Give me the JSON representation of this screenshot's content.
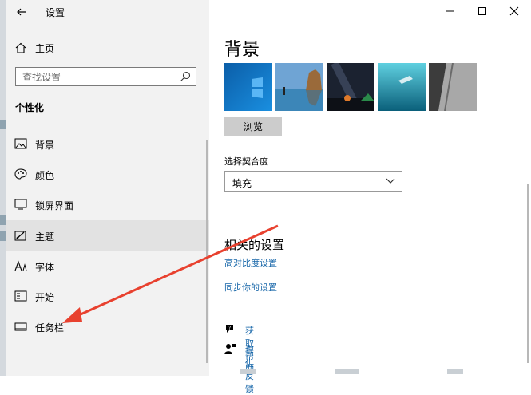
{
  "window": {
    "title": "设置"
  },
  "sidebar": {
    "home_label": "主页",
    "search_placeholder": "查找设置",
    "section_heading": "个性化",
    "items": [
      {
        "label": "背景",
        "icon": "image-icon"
      },
      {
        "label": "颜色",
        "icon": "palette-icon"
      },
      {
        "label": "锁屏界面",
        "icon": "lock-screen-icon"
      },
      {
        "label": "主题",
        "icon": "theme-icon",
        "selected": true
      },
      {
        "label": "字体",
        "icon": "font-icon"
      },
      {
        "label": "开始",
        "icon": "start-icon"
      },
      {
        "label": "任务栏",
        "icon": "taskbar-icon"
      }
    ]
  },
  "main": {
    "page_title": "背景",
    "browse_label": "浏览",
    "fit_label": "选择契合度",
    "fit_value": "填充",
    "related_title": "相关的设置",
    "links": [
      "高对比度设置",
      "同步你的设置"
    ],
    "help": {
      "get_help": "获取帮助",
      "feedback": "提供反馈"
    }
  },
  "colors": {
    "sidebar_bg": "#f2f2f2",
    "selected_bg": "#e2e2e2",
    "link": "#1565a8",
    "arrow": "#e8412f"
  }
}
